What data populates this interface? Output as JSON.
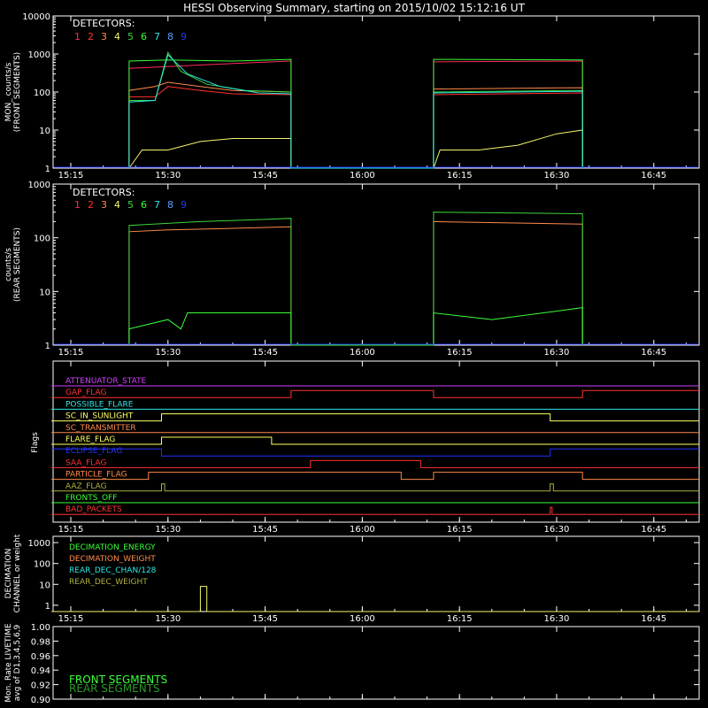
{
  "title": "HESSI Observing Summary, starting on 2015/10/02 15:12:16 UT",
  "time_axis": {
    "start": "15:12:16",
    "end": "16:52",
    "ticks": [
      "15:15",
      "15:30",
      "15:45",
      "16:00",
      "16:15",
      "16:30",
      "16:45"
    ]
  },
  "colors": {
    "axis": "#ffffff",
    "det1": "#ff2a5e",
    "det2": "#ff3030",
    "det3": "#ff8a4a",
    "det4": "#f5f56e",
    "det5": "#3ed63e",
    "det6": "#3aff3a",
    "det7": "#2ee6e6",
    "det8": "#5aa0ff",
    "det9": "#1e3cff",
    "baseline": "#2233ff"
  },
  "front_panel": {
    "ylabel": "MON_ counts/s",
    "ylabel2": "(FRONT SEGMENTS)",
    "legend_title": "DETECTORS:",
    "detector_labels": [
      "1",
      "2",
      "3",
      "4",
      "5",
      "6",
      "7",
      "8",
      "9"
    ],
    "ytick_labels": [
      "1",
      "10",
      "100",
      "1000",
      "10000"
    ]
  },
  "rear_panel": {
    "ylabel": "counts/s",
    "ylabel2": "(REAR SEGMENTS)",
    "legend_title": "DETECTORS:",
    "detector_labels": [
      "1",
      "2",
      "3",
      "4",
      "5",
      "6",
      "7",
      "8",
      "9"
    ],
    "ytick_labels": [
      "1",
      "10",
      "100",
      "1000"
    ]
  },
  "flags_panel": {
    "ylabel": "Flags",
    "flags": [
      {
        "name": "ATTENUATOR_STATE",
        "color": "#d040ff"
      },
      {
        "name": "GAP_FLAG",
        "color": "#ff3030"
      },
      {
        "name": "POSSIBLE_FLARE",
        "color": "#2ee6e6"
      },
      {
        "name": "SC_IN_SUNLIGHT",
        "color": "#ffff60"
      },
      {
        "name": "SC_TRANSMITTER",
        "color": "#ff8a4a"
      },
      {
        "name": "FLARE_FLAG",
        "color": "#ffff60"
      },
      {
        "name": "ECLIPSE_FLAG",
        "color": "#2233ff"
      },
      {
        "name": "SAA_FLAG",
        "color": "#ff3030"
      },
      {
        "name": "PARTICLE_FLAG",
        "color": "#ff8a4a"
      },
      {
        "name": "AAZ_FLAG",
        "color": "#b0b040"
      },
      {
        "name": "FRONTS_OFF",
        "color": "#3aff3a"
      },
      {
        "name": "BAD_PACKETS",
        "color": "#ff3030"
      }
    ]
  },
  "decimation_panel": {
    "ylabel": "DECIMATION",
    "ylabel2": "CHANNEL or weight",
    "ytick_labels": [
      "1",
      "10",
      "100",
      "1000"
    ],
    "legend": [
      {
        "name": "DECIMATION_ENERGY",
        "color": "#3aff3a"
      },
      {
        "name": "DECIMATION_WEIGHT",
        "color": "#ff8a4a"
      },
      {
        "name": "REAR_DEC_CHAN/128",
        "color": "#2ee6e6"
      },
      {
        "name": "REAR_DEC_WEIGHT",
        "color": "#b0b040"
      }
    ]
  },
  "livetime_panel": {
    "ylabel": "Mon. Rate LIVETIME",
    "ylabel2": "avg of D1,3,4,5,6,9",
    "ytick_labels": [
      "0.90",
      "0.92",
      "0.94",
      "0.96",
      "0.98",
      "1.00"
    ],
    "legend": [
      {
        "name": "FRONT SEGMENTS",
        "color": "#3aff3a"
      },
      {
        "name": "REAR SEGMENTS",
        "color": "#2a9a2a"
      }
    ]
  },
  "chart_data": [
    {
      "type": "line",
      "panel": "front",
      "x_unit": "UT time",
      "ylog": true,
      "ylim": [
        1,
        10000
      ],
      "xlim": [
        "15:12",
        "16:52"
      ],
      "observing_intervals": [
        [
          "15:24",
          "15:49"
        ],
        [
          "16:11",
          "16:34"
        ]
      ],
      "series": [
        {
          "name": "1",
          "color": "#ff2a5e",
          "points": [
            [
              "15:24",
              1
            ],
            [
              "15:24",
              420
            ],
            [
              "15:40",
              560
            ],
            [
              "15:49",
              650
            ],
            [
              "15:49",
              1
            ],
            [
              "16:11",
              1
            ],
            [
              "16:11",
              620
            ],
            [
              "16:34",
              650
            ],
            [
              "16:34",
              1
            ]
          ]
        },
        {
          "name": "2",
          "color": "#ff3030",
          "points": [
            [
              "15:24",
              1
            ],
            [
              "15:24",
              75
            ],
            [
              "15:28",
              75
            ],
            [
              "15:30",
              140
            ],
            [
              "15:35",
              110
            ],
            [
              "15:40",
              90
            ],
            [
              "15:49",
              85
            ],
            [
              "15:49",
              1
            ],
            [
              "16:11",
              1
            ],
            [
              "16:11",
              85
            ],
            [
              "16:34",
              95
            ],
            [
              "16:34",
              1
            ]
          ]
        },
        {
          "name": "3",
          "color": "#ff8a4a",
          "points": [
            [
              "15:24",
              1
            ],
            [
              "15:24",
              110
            ],
            [
              "15:28",
              140
            ],
            [
              "15:30",
              180
            ],
            [
              "15:35",
              140
            ],
            [
              "15:40",
              110
            ],
            [
              "15:49",
              100
            ],
            [
              "15:49",
              1
            ],
            [
              "16:11",
              1
            ],
            [
              "16:11",
              120
            ],
            [
              "16:34",
              130
            ],
            [
              "16:34",
              1
            ]
          ]
        },
        {
          "name": "4",
          "color": "#f5f56e",
          "points": [
            [
              "15:24",
              1
            ],
            [
              "15:26",
              3
            ],
            [
              "15:30",
              3
            ],
            [
              "15:35",
              5
            ],
            [
              "15:40",
              6
            ],
            [
              "15:45",
              6
            ],
            [
              "15:49",
              6
            ],
            [
              "15:49",
              1
            ],
            [
              "16:11",
              1
            ],
            [
              "16:12",
              3
            ],
            [
              "16:18",
              3
            ],
            [
              "16:24",
              4
            ],
            [
              "16:30",
              8
            ],
            [
              "16:34",
              10
            ],
            [
              "16:34",
              1
            ]
          ]
        },
        {
          "name": "5",
          "color": "#3ed63e",
          "points": [
            [
              "15:24",
              1
            ],
            [
              "15:24",
              60
            ],
            [
              "15:28",
              60
            ],
            [
              "15:30",
              1100
            ],
            [
              "15:32",
              350
            ],
            [
              "15:36",
              160
            ],
            [
              "15:42",
              110
            ],
            [
              "15:49",
              100
            ],
            [
              "15:49",
              1
            ],
            [
              "16:11",
              1
            ],
            [
              "16:11",
              100
            ],
            [
              "16:34",
              110
            ],
            [
              "16:34",
              1
            ]
          ]
        },
        {
          "name": "6",
          "color": "#3aff3a",
          "points": [
            [
              "15:24",
              1
            ],
            [
              "15:24",
              650
            ],
            [
              "15:30",
              700
            ],
            [
              "15:40",
              650
            ],
            [
              "15:49",
              720
            ],
            [
              "15:49",
              1
            ],
            [
              "16:11",
              1
            ],
            [
              "16:11",
              720
            ],
            [
              "16:34",
              700
            ],
            [
              "16:34",
              1
            ]
          ]
        },
        {
          "name": "7",
          "color": "#2ee6e6",
          "points": [
            [
              "15:24",
              1
            ],
            [
              "15:24",
              55
            ],
            [
              "15:28",
              60
            ],
            [
              "15:30",
              950
            ],
            [
              "15:33",
              300
            ],
            [
              "15:38",
              140
            ],
            [
              "15:44",
              95
            ],
            [
              "15:49",
              90
            ],
            [
              "15:49",
              1
            ],
            [
              "16:11",
              1
            ],
            [
              "16:11",
              95
            ],
            [
              "16:34",
              105
            ],
            [
              "16:34",
              1
            ]
          ]
        }
      ]
    },
    {
      "type": "line",
      "panel": "rear",
      "x_unit": "UT time",
      "ylog": true,
      "ylim": [
        1,
        1000
      ],
      "xlim": [
        "15:12",
        "16:52"
      ],
      "series": [
        {
          "name": "3",
          "color": "#ff8a4a",
          "points": [
            [
              "15:24",
              1
            ],
            [
              "15:24",
              130
            ],
            [
              "15:30",
              140
            ],
            [
              "15:40",
              150
            ],
            [
              "15:49",
              160
            ],
            [
              "15:49",
              1
            ],
            [
              "16:11",
              1
            ],
            [
              "16:11",
              200
            ],
            [
              "16:34",
              180
            ],
            [
              "16:34",
              1
            ]
          ]
        },
        {
          "name": "5",
          "color": "#3ed63e",
          "points": [
            [
              "15:24",
              1
            ],
            [
              "15:24",
              170
            ],
            [
              "15:35",
              200
            ],
            [
              "15:45",
              220
            ],
            [
              "15:49",
              230
            ],
            [
              "15:49",
              1
            ],
            [
              "16:11",
              1
            ],
            [
              "16:11",
              300
            ],
            [
              "16:34",
              280
            ],
            [
              "16:34",
              1
            ]
          ]
        },
        {
          "name": "6",
          "color": "#3aff3a",
          "points": [
            [
              "15:24",
              1
            ],
            [
              "15:24",
              2
            ],
            [
              "15:30",
              3
            ],
            [
              "15:32",
              2
            ],
            [
              "15:33",
              4
            ],
            [
              "15:45",
              4
            ],
            [
              "15:49",
              4
            ],
            [
              "15:49",
              1
            ],
            [
              "16:11",
              1
            ],
            [
              "16:11",
              4
            ],
            [
              "16:20",
              3
            ],
            [
              "16:28",
              4
            ],
            [
              "16:34",
              5
            ],
            [
              "16:34",
              1
            ]
          ]
        }
      ]
    },
    {
      "type": "flags",
      "panel": "flags",
      "flags": [
        {
          "name": "ATTENUATOR_STATE",
          "segments": [
            [
              "15:12",
              "16:52",
              0
            ]
          ]
        },
        {
          "name": "GAP_FLAG",
          "segments": [
            [
              "15:12",
              "15:49",
              0
            ],
            [
              "15:49",
              "16:11",
              1
            ],
            [
              "16:11",
              "16:34",
              0
            ],
            [
              "16:34",
              "16:52",
              1
            ]
          ]
        },
        {
          "name": "POSSIBLE_FLARE",
          "segments": [
            [
              "15:12",
              "16:52",
              0
            ]
          ]
        },
        {
          "name": "SC_IN_SUNLIGHT",
          "segments": [
            [
              "15:12",
              "15:29",
              0
            ],
            [
              "15:29",
              "16:29",
              1
            ],
            [
              "16:29",
              "16:52",
              0
            ]
          ]
        },
        {
          "name": "SC_TRANSMITTER",
          "segments": [
            [
              "15:12",
              "16:52",
              0
            ]
          ]
        },
        {
          "name": "FLARE_FLAG",
          "segments": [
            [
              "15:12",
              "15:29",
              0
            ],
            [
              "15:29",
              "15:46",
              1
            ],
            [
              "15:46",
              "16:52",
              0
            ]
          ]
        },
        {
          "name": "ECLIPSE_FLAG",
          "segments": [
            [
              "15:12",
              "15:29",
              1
            ],
            [
              "15:29",
              "16:29",
              0
            ],
            [
              "16:29",
              "16:52",
              1
            ]
          ]
        },
        {
          "name": "SAA_FLAG",
          "segments": [
            [
              "15:12",
              "15:52",
              0
            ],
            [
              "15:52",
              "16:09",
              1
            ],
            [
              "16:09",
              "16:52",
              0
            ]
          ]
        },
        {
          "name": "PARTICLE_FLAG",
          "segments": [
            [
              "15:12",
              "15:27",
              0
            ],
            [
              "15:27",
              "16:06",
              1
            ],
            [
              "16:06",
              "16:11",
              0
            ],
            [
              "16:11",
              "16:34",
              1
            ],
            [
              "16:34",
              "16:52",
              0
            ]
          ]
        },
        {
          "name": "AAZ_FLAG",
          "segments": [
            [
              "15:12",
              "15:29",
              0
            ],
            [
              "15:29",
              "15:29.5",
              1
            ],
            [
              "15:29.5",
              "16:29",
              0
            ],
            [
              "16:29",
              "16:29.5",
              1
            ],
            [
              "16:29.5",
              "16:52",
              0
            ]
          ]
        },
        {
          "name": "FRONTS_OFF",
          "segments": [
            [
              "15:12",
              "16:52",
              0
            ]
          ]
        },
        {
          "name": "BAD_PACKETS",
          "segments": [
            [
              "15:12",
              "16:29",
              0
            ],
            [
              "16:29",
              "16:29.3",
              1
            ],
            [
              "16:29.3",
              "16:52",
              0
            ]
          ]
        }
      ]
    },
    {
      "type": "line",
      "panel": "decimation",
      "ylog": true,
      "ylim": [
        0.5,
        2000
      ],
      "series": [
        {
          "name": "DECIMATION_WEIGHT",
          "color": "#f5f56e",
          "points": [
            [
              "15:12",
              0.5
            ],
            [
              "15:35",
              0.5
            ],
            [
              "15:35",
              8
            ],
            [
              "15:36",
              8
            ],
            [
              "15:36",
              0.5
            ],
            [
              "16:52",
              0.5
            ]
          ]
        }
      ]
    },
    {
      "type": "line",
      "panel": "livetime",
      "ylim": [
        0.9,
        1.0
      ],
      "series": []
    }
  ]
}
